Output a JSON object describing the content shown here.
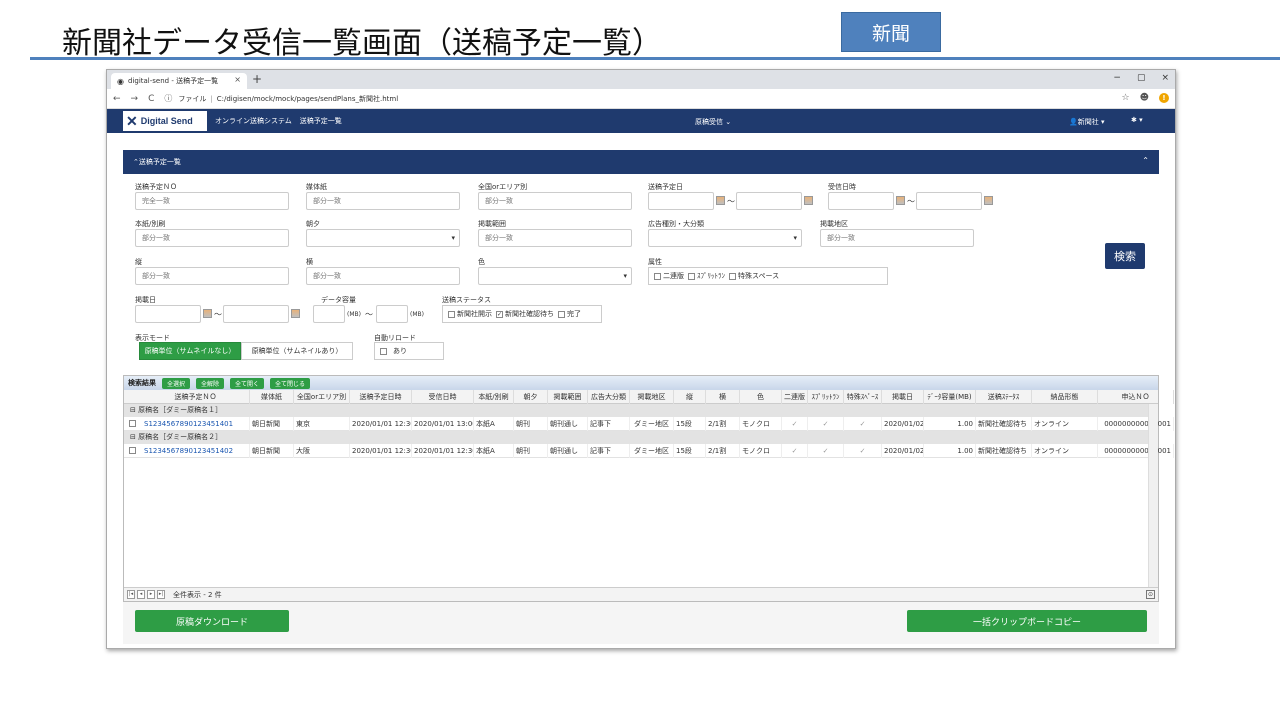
{
  "slide": {
    "title": "新聞社データ受信一覧画面（送稿予定一覧）",
    "badge": "新聞"
  },
  "browser": {
    "tab_title": "digital-send - 送稿予定一覧",
    "tab_close": "×",
    "new_tab": "+",
    "minimize": "−",
    "maximize": "▢",
    "close": "×",
    "url_prefix": "ファイル",
    "url": "C:/digisen/mock/mock/pages/sendPlans_新聞社.html"
  },
  "app": {
    "logo": "Digital Send",
    "system_name": "オンライン送稿システム",
    "page_name": "送稿予定一覧",
    "center_menu": "原稿受信",
    "user_menu": "新聞社",
    "colors": {
      "navy": "#1f3a6e",
      "green": "#2e9d45",
      "slide_blue": "#4f81bd"
    }
  },
  "panel": {
    "header": "送稿予定一覧"
  },
  "form": {
    "plan_no": {
      "label": "送稿予定ＮＯ",
      "placeholder": "完全一致"
    },
    "media": {
      "label": "媒体紙",
      "placeholder": "部分一致"
    },
    "area": {
      "label": "全国orエリア別",
      "placeholder": "部分一致"
    },
    "plan_date": {
      "label": "送稿予定日"
    },
    "recv_datetime": {
      "label": "受信日時"
    },
    "edition": {
      "label": "本紙/別刷",
      "placeholder": "部分一致"
    },
    "morning_evening": {
      "label": "朝夕"
    },
    "range": {
      "label": "掲載範囲",
      "placeholder": "部分一致"
    },
    "ad_category": {
      "label": "広告種別・大分類"
    },
    "region": {
      "label": "掲載地区",
      "placeholder": "部分一致"
    },
    "height": {
      "label": "縦",
      "placeholder": "部分一致"
    },
    "width": {
      "label": "横",
      "placeholder": "部分一致"
    },
    "color": {
      "label": "色"
    },
    "attr": {
      "label": "属性",
      "options": [
        "二連版",
        "ｽﾌﾟﾘｯﾄﾗﾝ",
        "特殊スペース"
      ]
    },
    "pub_date": {
      "label": "掲載日"
    },
    "data_size": {
      "label": "データ容量",
      "unit": "(MB)"
    },
    "send_status": {
      "label": "送稿ステータス",
      "options": [
        "新聞社開示",
        "新聞社確認待ち",
        "完了"
      ],
      "checked_mark": "✓"
    },
    "display_mode": {
      "label": "表示モード",
      "option_on": "原稿単位（サムネイルなし）",
      "option_off": "原稿単位（サムネイルあり）"
    },
    "auto_reload": {
      "label": "自動リロード",
      "option": "あり"
    },
    "tilde": "～",
    "search_button": "検索"
  },
  "results": {
    "label": "検索結果",
    "buttons": [
      "全選択",
      "全解除",
      "全て開く",
      "全て閉じる"
    ],
    "columns": [
      "送稿予定ＮＯ",
      "媒体紙",
      "全国orエリア別",
      "送稿予定日時",
      "受信日時",
      "本紙/別刷",
      "朝夕",
      "掲載範囲",
      "広告大分類",
      "掲載地区",
      "縦",
      "横",
      "色",
      "二連版",
      "ｽﾌﾟﾘｯﾄﾗﾝ",
      "特殊ｽﾍﾟｰｽ",
      "掲載日",
      "ﾃﾞｰﾀ容量(MB)",
      "送稿ｽﾃｰﾀｽ",
      "納品形態",
      "申込ＮＯ"
    ],
    "groups": [
      {
        "label": "原稿名［ダミー原稿名１］",
        "row": [
          "S1234567890123451401",
          "朝日新聞",
          "東京",
          "2020/01/01 12:30",
          "2020/01/01 13:00",
          "本紙A",
          "朝刊",
          "朝刊通し",
          "記事下",
          "ダミー地区",
          "15段",
          "2/1割",
          "モノクロ",
          "✓",
          "✓",
          "✓",
          "2020/01/02",
          "1.00",
          "新聞社確認待ち",
          "オンライン",
          "000000000000001"
        ]
      },
      {
        "label": "原稿名［ダミー原稿名２］",
        "row": [
          "S1234567890123451402",
          "朝日新聞",
          "大阪",
          "2020/01/01 12:30",
          "2020/01/01 12:30",
          "本紙A",
          "朝刊",
          "朝刊通し",
          "記事下",
          "ダミー地区",
          "15段",
          "2/1割",
          "モノクロ",
          "✓",
          "✓",
          "✓",
          "2020/01/02",
          "1.00",
          "新聞社確認待ち",
          "オンライン",
          "000000000000001"
        ]
      }
    ],
    "pager_text": "全件表示 - 2 件"
  },
  "footer": {
    "download_button": "原稿ダウンロード",
    "clipboard_button": "一括クリップボードコピー"
  }
}
